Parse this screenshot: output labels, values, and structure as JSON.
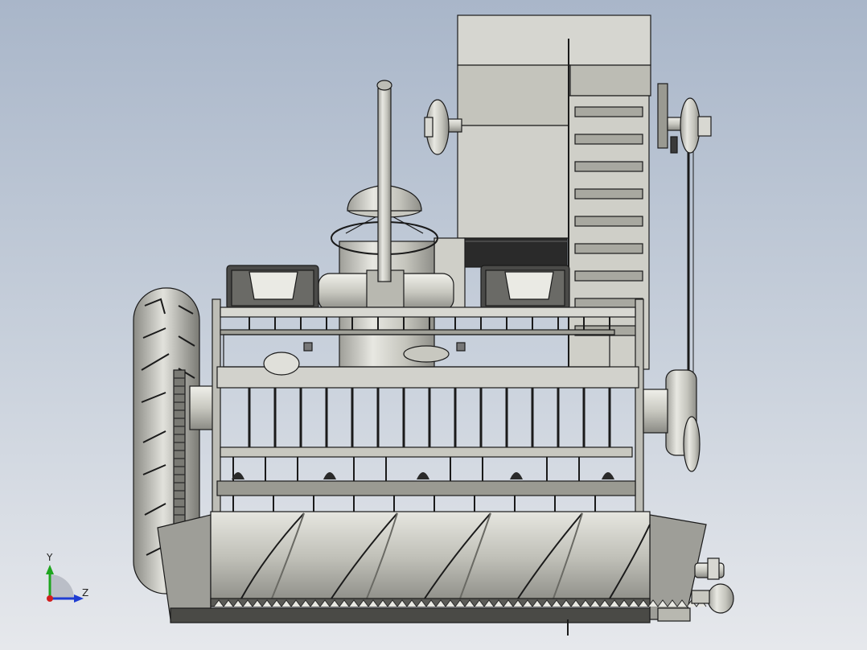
{
  "viewport": {
    "background_top": "#a9b6c9",
    "background_bottom": "#e6e8ec",
    "part_fill": "#d2d2cc",
    "part_shade": "#a8a8a0",
    "part_edge": "#1a1a1a"
  },
  "axis_triad": {
    "y_label": "Y",
    "z_label": "Z",
    "y_color": "#1ea51e",
    "z_color": "#1e3cd2",
    "x_color": "#d21e1e"
  }
}
